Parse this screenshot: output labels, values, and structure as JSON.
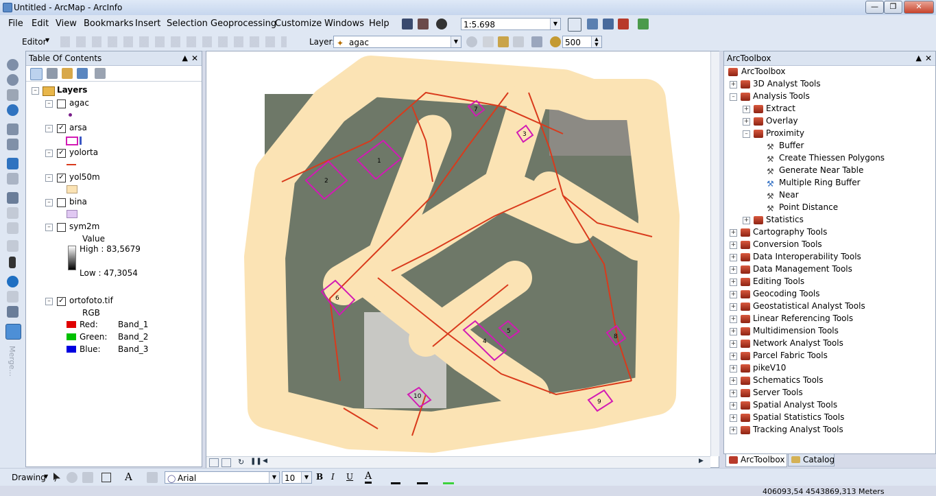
{
  "window": {
    "title": "Untitled - ArcMap - ArcInfo"
  },
  "menubar": {
    "items": [
      "File",
      "Edit",
      "View",
      "Bookmarks",
      "Insert",
      "Selection",
      "Geoprocessing",
      "Customize",
      "Windows",
      "Help"
    ]
  },
  "toolbar": {
    "scale": "1:5.698"
  },
  "editor": {
    "label": "Editor",
    "layer_label": "Layer:",
    "layer_value": "agac",
    "radius_value": "500"
  },
  "toc": {
    "title": "Table Of Contents",
    "root": "Layers",
    "layers": [
      {
        "name": "agac",
        "checked": false
      },
      {
        "name": "arsa",
        "checked": true
      },
      {
        "name": "yolorta",
        "checked": true
      },
      {
        "name": "yol50m",
        "checked": true
      },
      {
        "name": "bina",
        "checked": false
      },
      {
        "name": "sym2m",
        "checked": false
      },
      {
        "name": "ortofoto.tif",
        "checked": true
      }
    ],
    "sym2m_value_label": "Value",
    "sym2m_high": "High : 83,5679",
    "sym2m_low": "Low : 47,3054",
    "rgb_label": "RGB",
    "bands": [
      {
        "label": "Red:",
        "band": "Band_1",
        "color": "#e00000"
      },
      {
        "label": "Green:",
        "band": "Band_2",
        "color": "#00c000"
      },
      {
        "label": "Blue:",
        "band": "Band_3",
        "color": "#0000e0"
      }
    ]
  },
  "map": {
    "parcel_labels": [
      "2",
      "1",
      "7",
      "3",
      "6",
      "4",
      "5",
      "8",
      "9",
      "10"
    ]
  },
  "toolbox": {
    "title": "ArcToolbox",
    "root": "ArcToolbox",
    "items": [
      "3D Analyst Tools",
      "Analysis Tools",
      "Extract",
      "Overlay",
      "Proximity",
      "Buffer",
      "Create Thiessen Polygons",
      "Generate Near Table",
      "Multiple Ring Buffer",
      "Near",
      "Point Distance",
      "Statistics",
      "Cartography Tools",
      "Conversion Tools",
      "Data Interoperability Tools",
      "Data Management Tools",
      "Editing Tools",
      "Geocoding Tools",
      "Geostatistical Analyst Tools",
      "Linear Referencing Tools",
      "Multidimension Tools",
      "Network Analyst Tools",
      "Parcel Fabric Tools",
      "pikeV10",
      "Schematics Tools",
      "Server Tools",
      "Spatial Analyst Tools",
      "Spatial Statistics Tools",
      "Tracking Analyst Tools"
    ],
    "tabs": [
      "ArcToolbox",
      "Catalog"
    ]
  },
  "drawing": {
    "label": "Drawing",
    "font": "Arial",
    "size": "10",
    "bold": "B",
    "italic": "I",
    "underline": "U",
    "font_color": "A"
  },
  "status": {
    "coords": "406093,54  4543869,313 Meters"
  },
  "left_strip": {
    "merge_label": "Merge..."
  },
  "colors": {
    "buffer": "#fbe3b4",
    "road": "#d93a1c",
    "parcel": "#d21ab4"
  }
}
